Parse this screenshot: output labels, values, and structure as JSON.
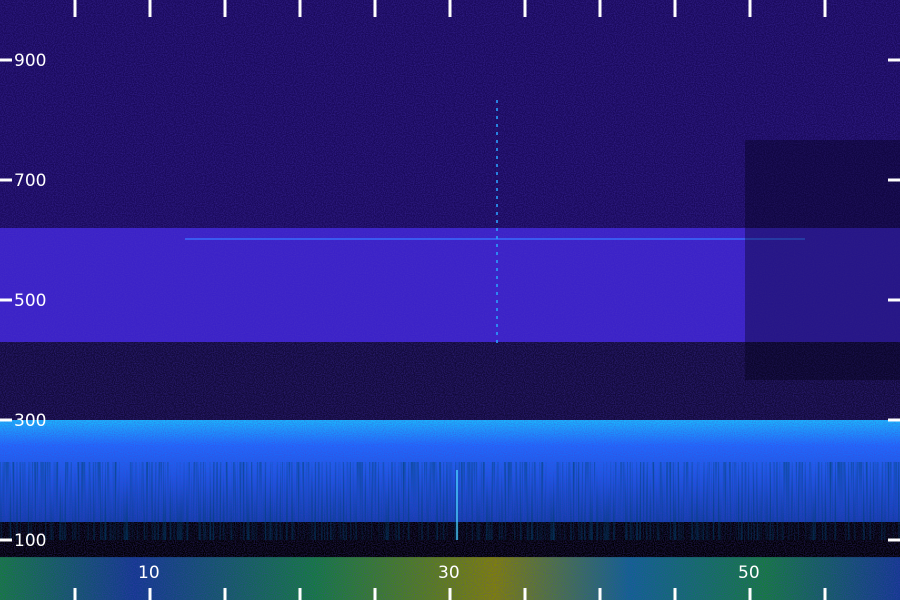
{
  "chart_data": {
    "type": "heatmap",
    "title": "",
    "xlabel": "",
    "ylabel": "",
    "xlim": [
      0,
      60
    ],
    "ylim": [
      0,
      1000
    ],
    "x_tick_values": [
      5,
      10,
      15,
      20,
      25,
      30,
      35,
      40,
      45,
      50,
      55
    ],
    "x_tick_labels": [
      {
        "value": 10,
        "text": "10"
      },
      {
        "value": 30,
        "text": "30"
      },
      {
        "value": 50,
        "text": "50"
      }
    ],
    "y_tick_values": [
      100,
      300,
      500,
      700,
      900
    ],
    "y_tick_labels": [
      {
        "value": 100,
        "text": "100"
      },
      {
        "value": 300,
        "text": "300"
      },
      {
        "value": 500,
        "text": "500"
      },
      {
        "value": 700,
        "text": "700"
      },
      {
        "value": 900,
        "text": "900"
      }
    ],
    "bands": [
      {
        "y_from": 620,
        "y_to": 1000,
        "intensity": "medium-low"
      },
      {
        "y_from": 430,
        "y_to": 620,
        "intensity": "medium"
      },
      {
        "y_from": 300,
        "y_to": 430,
        "intensity": "low"
      },
      {
        "y_from": 130,
        "y_to": 300,
        "intensity": "high"
      },
      {
        "y_from": 0,
        "y_to": 130,
        "intensity": "very-high"
      }
    ],
    "colormap": [
      "#000000",
      "#1a0a5c",
      "#3b22c8",
      "#1f6bff",
      "#19b8ff",
      "#22e36b",
      "#e8f000"
    ],
    "grid": false,
    "legend": "none"
  }
}
